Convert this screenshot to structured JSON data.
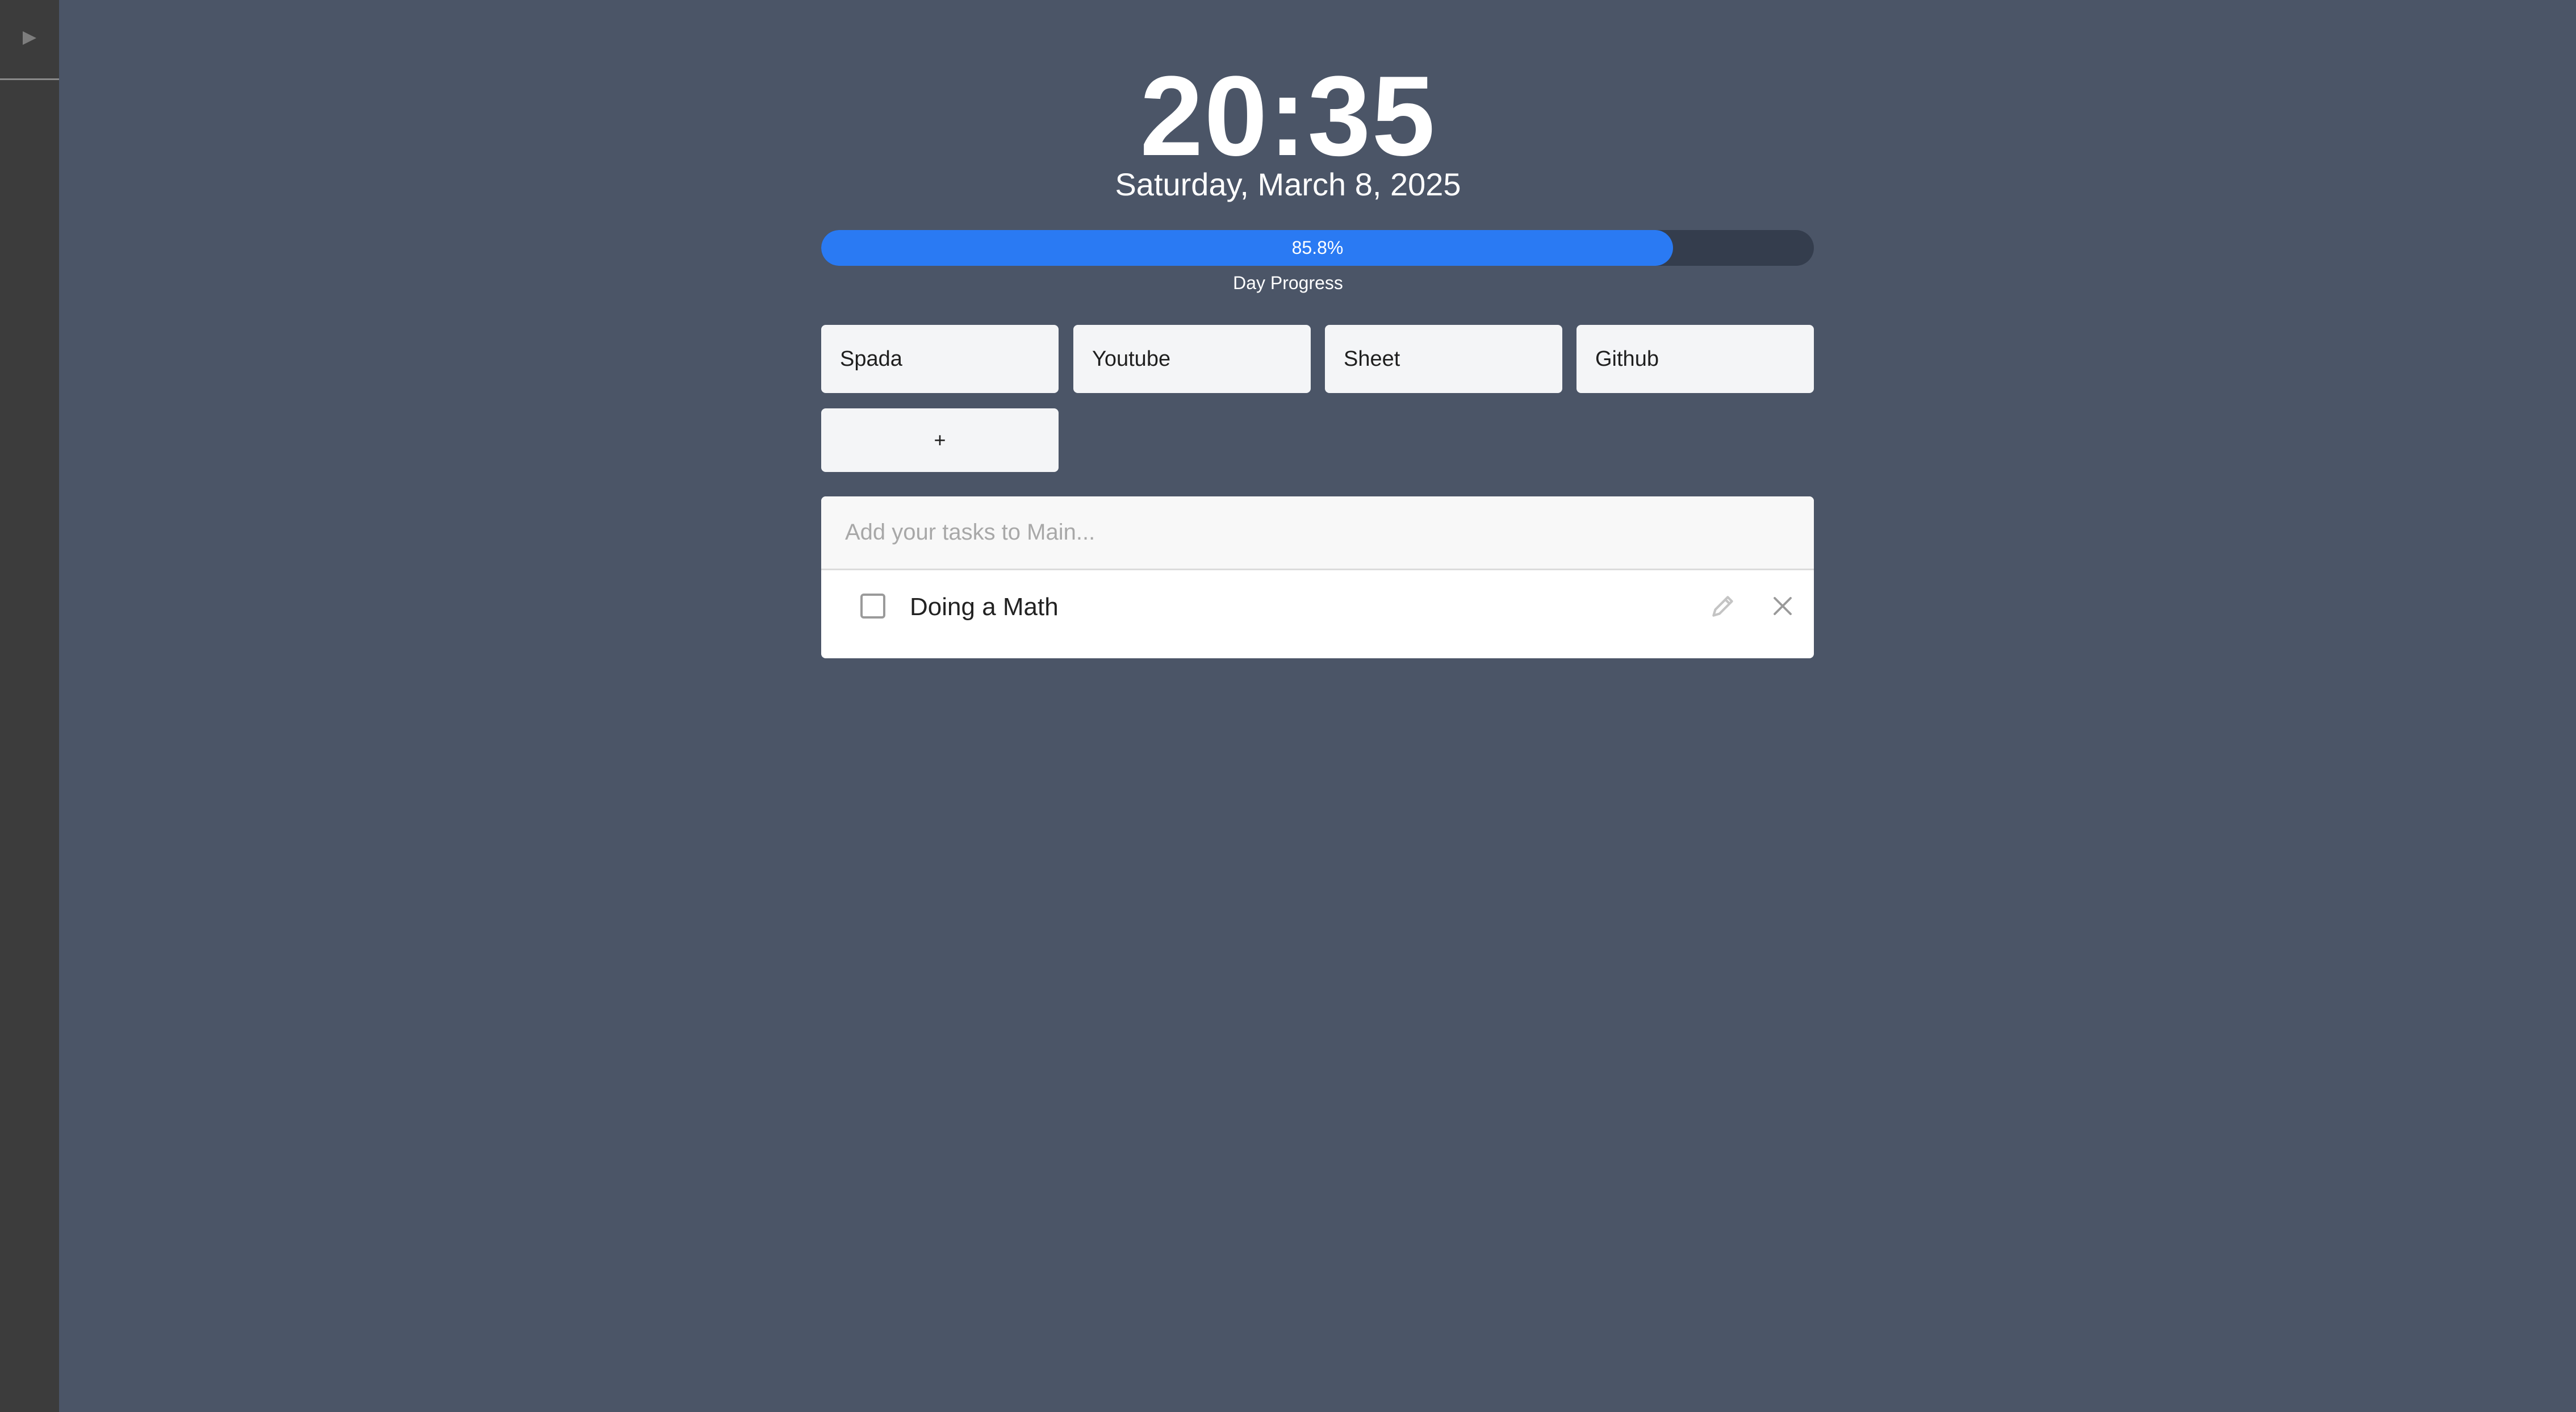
{
  "sidebar": {
    "toggle_icon": "play-triangle-icon"
  },
  "clock": {
    "time": "20:35",
    "date": "Saturday, March 8, 2025"
  },
  "day_progress": {
    "percent": 85.8,
    "percent_text": "85.8%",
    "label": "Day Progress",
    "fill_color": "#2a7af3",
    "track_color": "#343d4d"
  },
  "shortcuts": [
    {
      "label": "Spada"
    },
    {
      "label": "Youtube"
    },
    {
      "label": "Sheet"
    },
    {
      "label": "Github"
    }
  ],
  "add_shortcut": {
    "label": "+"
  },
  "tasks": {
    "input_placeholder": "Add your tasks to Main...",
    "input_value": "",
    "items": [
      {
        "text": "Doing a Math",
        "checked": false,
        "edit_icon": "pencil-icon",
        "delete_icon": "close-icon"
      }
    ]
  },
  "colors": {
    "background": "#4b5567",
    "sidebar": "#3c3c3c"
  }
}
